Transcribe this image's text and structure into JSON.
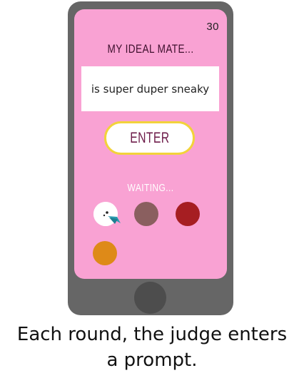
{
  "screen": {
    "timer": "30",
    "title": "MY IDEAL MATE...",
    "prompt": "is super duper sneaky",
    "enter_label": "ENTER",
    "waiting_label": "WAITING..."
  },
  "players": [
    {
      "color": "#ffffff",
      "avatar": "bird-icon"
    },
    {
      "color": "#8a5f5f"
    },
    {
      "color": "#a61e22"
    },
    {
      "color": "#de8a18"
    }
  ],
  "caption": {
    "line1": "Each round, the judge enters",
    "line2": "a prompt."
  }
}
